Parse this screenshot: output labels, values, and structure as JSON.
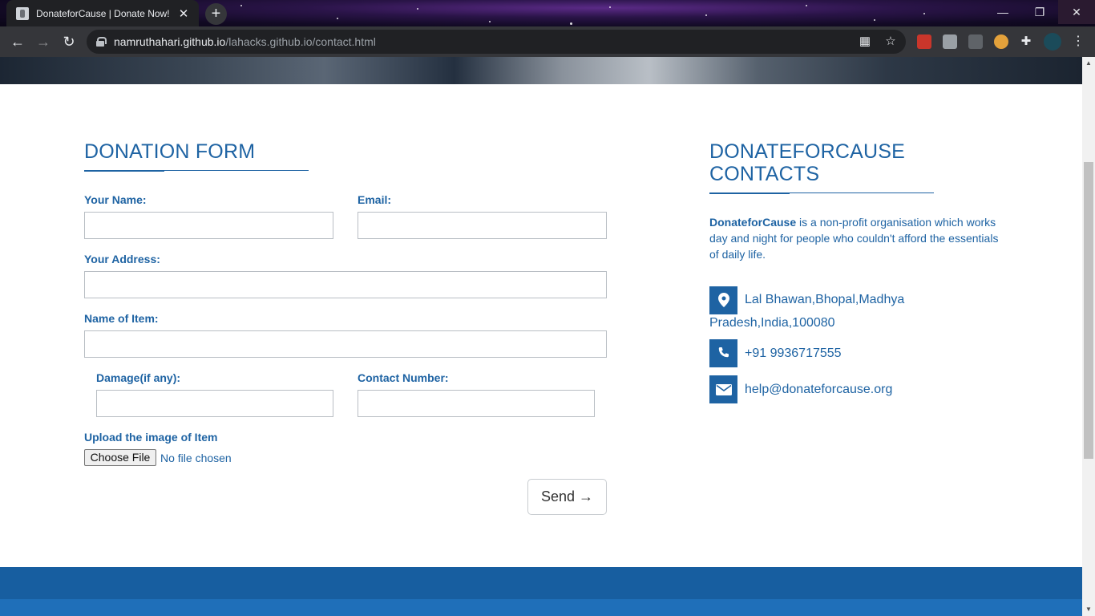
{
  "browser": {
    "tab_title": "DonateforCause | Donate Now!",
    "tab_close": "✕",
    "new_tab": "+",
    "window_controls": {
      "minimize": "—",
      "restore": "❐",
      "close": "✕"
    },
    "url_host": "namruthahari.github.io",
    "url_path": "/lahacks.github.io/contact.html",
    "nav": {
      "back": "←",
      "forward": "→",
      "reload": "↻"
    }
  },
  "form": {
    "title": "DONATION FORM",
    "labels": {
      "name": "Your Name:",
      "email": "Email:",
      "address": "Your Address:",
      "item": "Name of Item:",
      "damage": "Damage(if any):",
      "contact_number": "Contact Number:",
      "upload": "Upload the image of Item"
    },
    "values": {
      "name": "",
      "email": "",
      "address": "",
      "item": "",
      "damage": "",
      "contact_number": ""
    },
    "file_button": "Choose File",
    "file_status": "No file chosen",
    "send_button": "Send →"
  },
  "contacts": {
    "title_line1": "DONATEFORCAUSE",
    "title_line2": "CONTACTS",
    "about_brand": "DonateforCause",
    "about_text": " is a non-profit organisation which works day and night for people who couldn't afford the essentials of daily life.",
    "address_line1": "Lal Bhawan,Bhopal,Madhya",
    "address_line2": "Pradesh,India,100080",
    "phone": "+91 9936717555",
    "email": "help@donateforcause.org",
    "icons": [
      "map-marker-icon",
      "phone-icon",
      "envelope-icon"
    ]
  },
  "colors": {
    "accent": "#1e63a3",
    "footer": "#175ea0"
  }
}
